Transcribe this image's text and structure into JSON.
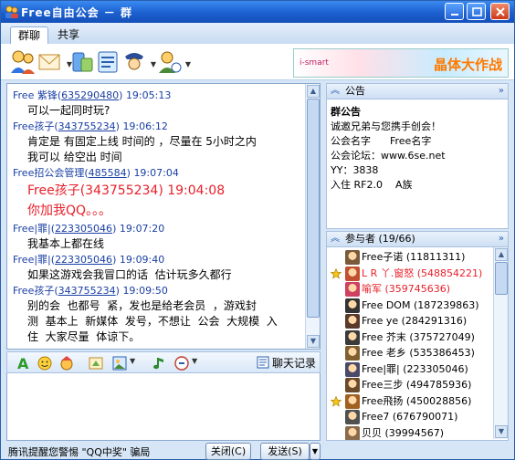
{
  "window": {
    "title": "Free自由公会 － 群",
    "controls": [
      "minimize-icon",
      "maximize-icon",
      "close-icon"
    ]
  },
  "tabs": [
    {
      "label": "群聊",
      "active": true
    },
    {
      "label": "共享",
      "active": false
    }
  ],
  "toolbar": {
    "icons": [
      "group-members-icon",
      "mail-icon",
      "share-icon",
      "settings-icon",
      "view-profile-icon"
    ]
  },
  "banner": {
    "text": "晶体大作战",
    "brand": "i-smart"
  },
  "chat": {
    "messages": [
      {
        "sender": "Free 紫锋",
        "qq": "635290480",
        "time": "19:05:13",
        "lines": [
          "可以一起同时玩?"
        ]
      },
      {
        "sender": "Free孩子",
        "qq": "343755234",
        "time": "19:06:12",
        "lines": [
          "肯定是 有固定上线 时间的 ，尽量在 5小时之内",
          "我可以 给空出 时间"
        ]
      },
      {
        "sender": "Free招公会管理",
        "qq": "485584",
        "time": "19:07:04",
        "lines": [],
        "big_lines": [
          "Free孩子(343755234) 19:04:08",
          "",
          "你加我QQ。。。"
        ]
      },
      {
        "sender": "Free|罪|",
        "qq": "223305046",
        "time": "19:07:20",
        "lines": [
          "我基本上都在线"
        ]
      },
      {
        "sender": "Free|罪|",
        "qq": "223305046",
        "time": "19:09:40",
        "lines": [
          "如果这游戏会我冒口的话  估计玩多久都行"
        ]
      },
      {
        "sender": "Free孩子",
        "qq": "343755234",
        "time": "19:09:50",
        "lines": [
          "别的会  也都号  紧，发也是给老会员  ，游戏封",
          "测  基本上  新媒体  发号，不想让  公会  大规模  入",
          "住  大家尽量  体谅下。"
        ]
      }
    ]
  },
  "format_bar": {
    "icons": [
      "font-icon",
      "emoji-icon",
      "magic-face-icon",
      "screenshot-icon",
      "image-icon",
      "music-icon",
      "voice-icon"
    ],
    "history_label": "聊天记录"
  },
  "bottom": {
    "tip": "腾讯提醒您警惕 \"QQ中奖\" 骗局",
    "close_label": "关闭(C)",
    "send_label": "发送(S)"
  },
  "announcement": {
    "header": "公告",
    "lines": [
      "群公告",
      "诚邀兄弟与您携手创会！",
      "公会名字      Free名字",
      "公会论坛：www.6se.net",
      "YY：3838",
      "入住 RF2.0    A族"
    ]
  },
  "members": {
    "header": "参与者 (19/66)",
    "list": [
      {
        "name": "Free子诺 (11811311)",
        "crown": false,
        "red": false
      },
      {
        "name": "L R 丫.窗怒 (548854221)",
        "crown": true,
        "red": true
      },
      {
        "name": "喻军 (359745636)",
        "crown": false,
        "red": true
      },
      {
        "name": "Free DOM (187239863)",
        "crown": false,
        "red": false
      },
      {
        "name": "Free ye (284291316)",
        "crown": false,
        "red": false
      },
      {
        "name": "Free 芥末 (375727049)",
        "crown": false,
        "red": false
      },
      {
        "name": "Free 老乡 (535386453)",
        "crown": false,
        "red": false
      },
      {
        "name": "Free|罪| (223305046)",
        "crown": false,
        "red": false
      },
      {
        "name": "Free三步 (494785936)",
        "crown": false,
        "red": false
      },
      {
        "name": "Free飛扬 (450028856)",
        "crown": true,
        "red": false
      },
      {
        "name": "Free7 (676790071)",
        "crown": false,
        "red": false
      },
      {
        "name": "贝贝 (39994567)",
        "crown": false,
        "red": false
      }
    ]
  },
  "colors": {
    "accent": "#1b5fcf",
    "name_link": "#1b40a4",
    "highlight_red": "#e8202a"
  }
}
